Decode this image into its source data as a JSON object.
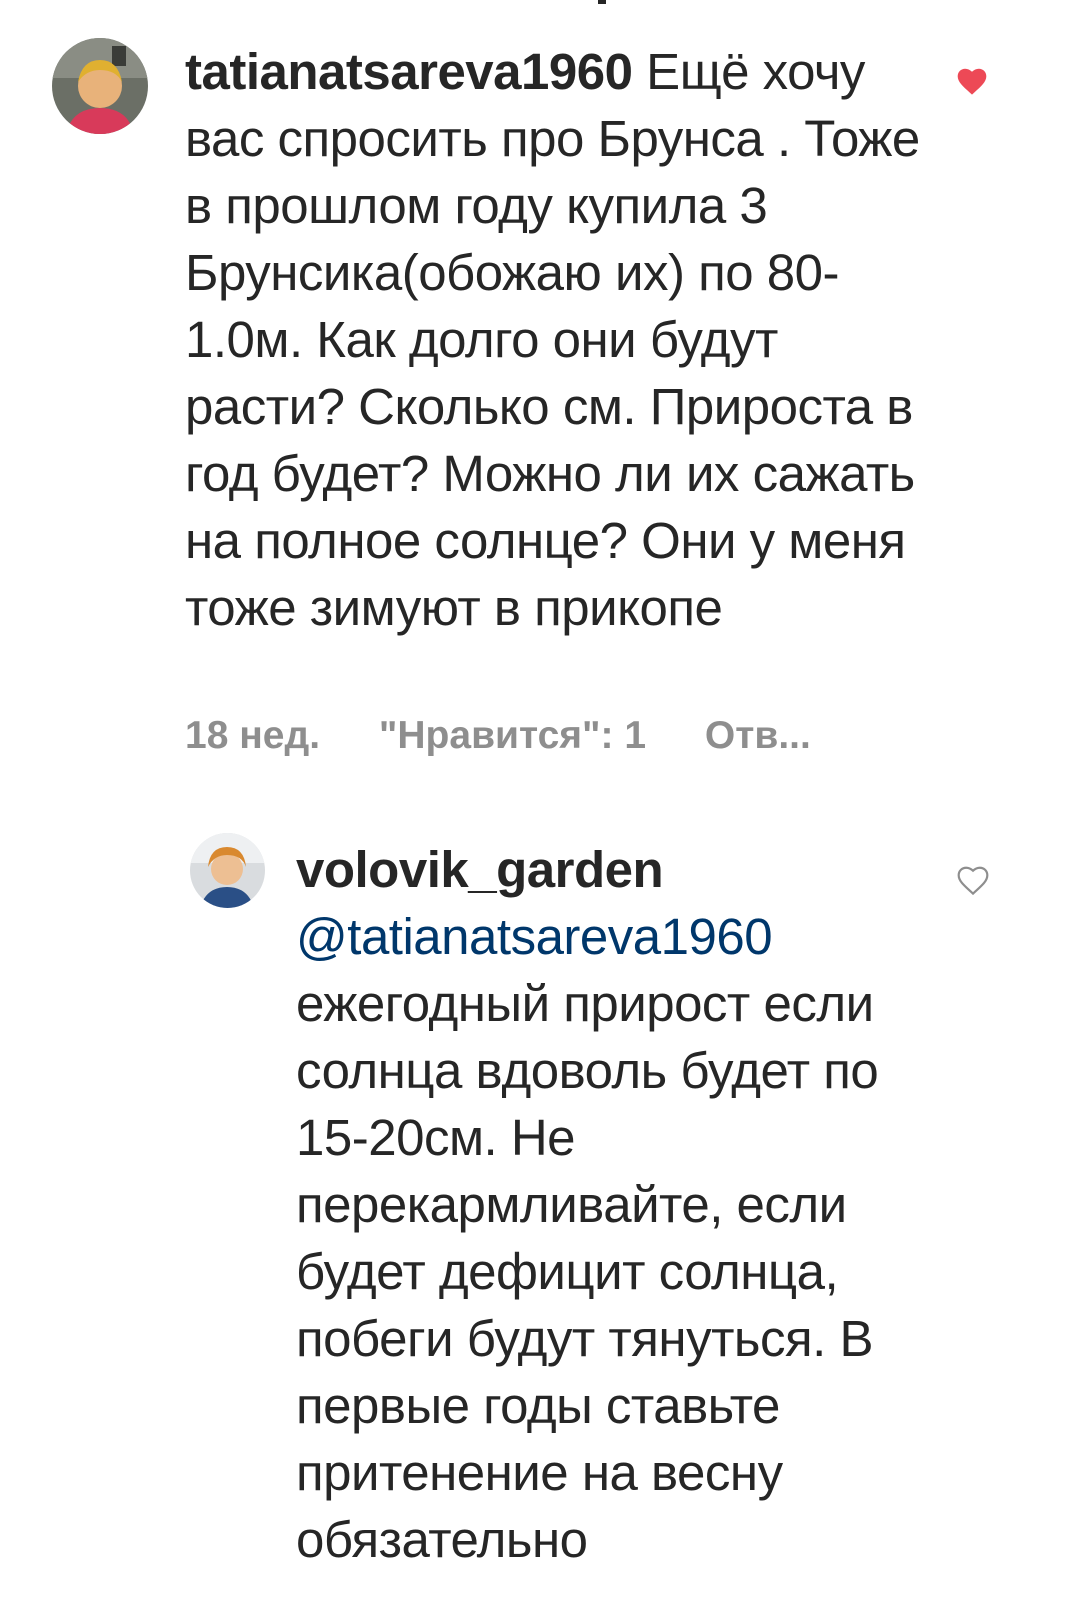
{
  "comments": [
    {
      "username": "tatianatsareva1960",
      "text": "Ещё хочу вас спросить про Брунса . Тоже в прошлом году купила 3 Брунсика(обожаю их)  по 80-1.0м.  Как долго они будут расти? Сколько см. Прироста в год будет? Можно ли их сажать на полное солнце? Они у меня тоже зимуют в прикопе",
      "time": "18 нед.",
      "likes": "\"Нравится\": 1",
      "reply": "Отв...",
      "liked": true,
      "heart_color": "#ed4956"
    },
    {
      "username": "volovik_garden",
      "mention": "@tatianatsareva1960",
      "text": "ежегодный прирост если солнца вдоволь будет по 15-20см. Не перекармливайте, если будет дефицит солнца, побеги будут тянуться. В первые годы ставьте притенение на весну обязательно",
      "liked": false,
      "heart_color": "#8e8e8e"
    }
  ],
  "icons": {
    "liked_heart": "heart-filled-icon",
    "like_outline": "heart-outline-icon"
  }
}
